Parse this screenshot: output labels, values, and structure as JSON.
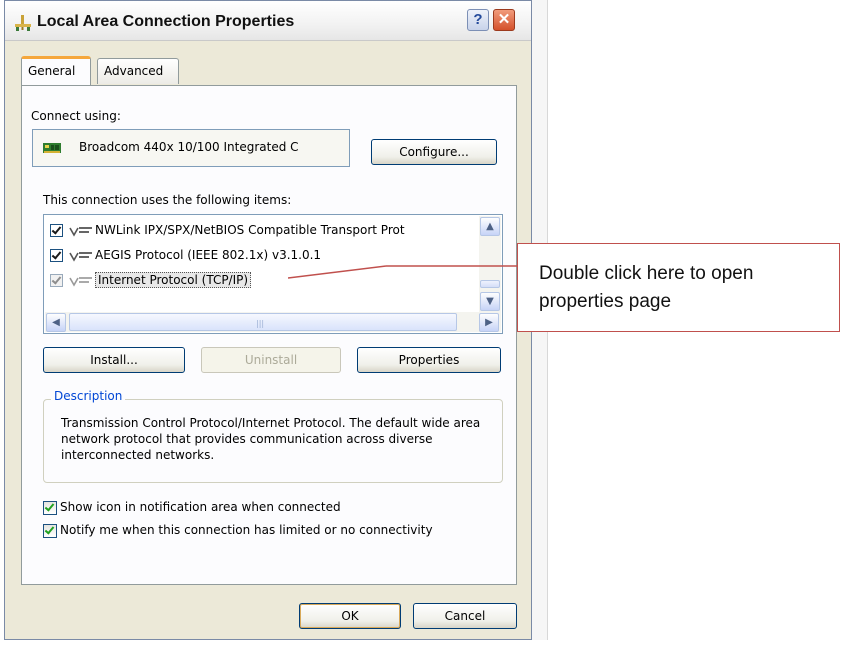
{
  "window": {
    "title": "Local Area Connection Properties",
    "help_label": "?",
    "close_label": "✕"
  },
  "tabs": [
    {
      "label": "General",
      "active": true
    },
    {
      "label": "Advanced",
      "active": false
    }
  ],
  "connect_using": {
    "label": "Connect using:",
    "adapter": "Broadcom 440x 10/100 Integrated C",
    "configure_label": "Configure..."
  },
  "items_section": {
    "label": "This connection uses the following items:",
    "items": [
      {
        "label": "NWLink IPX/SPX/NetBIOS Compatible Transport Prot",
        "checked": true,
        "selected": false
      },
      {
        "label": "AEGIS Protocol (IEEE 802.1x) v3.1.0.1",
        "checked": true,
        "selected": false
      },
      {
        "label": "Internet Protocol (TCP/IP)",
        "checked": true,
        "selected": true
      }
    ]
  },
  "actions": {
    "install_label": "Install...",
    "uninstall_label": "Uninstall",
    "properties_label": "Properties"
  },
  "description": {
    "title": "Description",
    "text": "Transmission Control Protocol/Internet Protocol. The default wide area network protocol that provides communication across diverse interconnected networks."
  },
  "options": {
    "show_icon_label": "Show icon in notification area when connected",
    "show_icon_checked": true,
    "notify_label": "Notify me when this connection has limited or no connectivity",
    "notify_checked": true
  },
  "footer": {
    "ok_label": "OK",
    "cancel_label": "Cancel"
  },
  "callout": {
    "text": "Double click here to open properties page"
  },
  "colors": {
    "accent_tab": "#f5a73c",
    "group_title": "#0046d5",
    "callout_border": "#c0504d",
    "dialog_face": "#ECE9D8"
  }
}
